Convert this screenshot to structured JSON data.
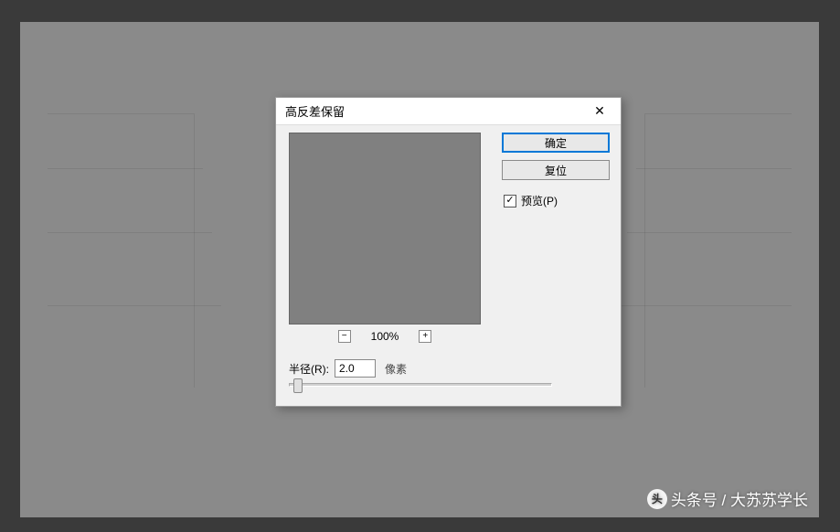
{
  "dialog": {
    "title": "高反差保留",
    "close_glyph": "✕",
    "ok_label": "确定",
    "reset_label": "复位",
    "preview_label": "预览(P)",
    "preview_checked": "✓",
    "zoom_minus": "−",
    "zoom_plus": "+",
    "zoom_value": "100%",
    "radius_label": "半径(R):",
    "radius_value": "2.0",
    "radius_unit": "像素"
  },
  "watermark": {
    "logo_glyph": "头",
    "text": "头条号 / 大苏苏学长"
  }
}
